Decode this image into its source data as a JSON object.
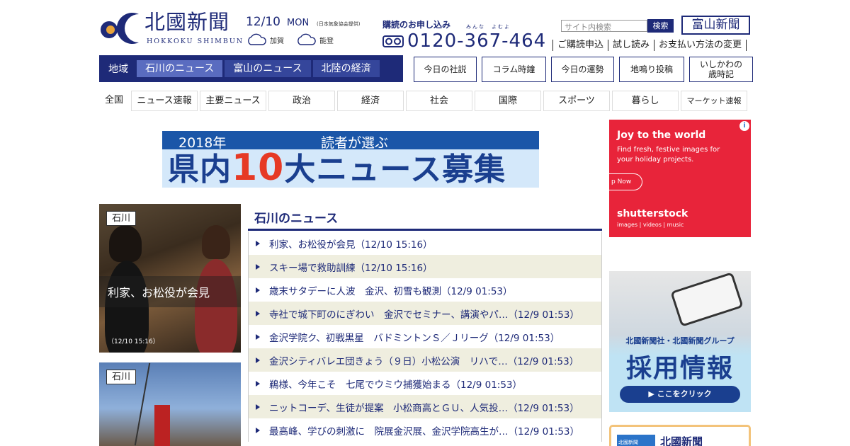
{
  "header": {
    "logo_title": "北國新聞",
    "logo_sub": "HOKKOKU SHIMBUN",
    "date": "12/10",
    "weekday": "MON",
    "weather_note": "(日本気象協会提供)",
    "weather": [
      {
        "area": "加賀",
        "icon": "cloud-icon"
      },
      {
        "area": "能登",
        "icon": "cloud-icon"
      }
    ],
    "subscribe_title": "購読のお申し込み",
    "subscribe_ruby": "みんな　よむよ",
    "phone": "0120-367-464",
    "search_placeholder": "サイト内検索",
    "search_button": "検索",
    "toyama_link": "富山新聞",
    "top_links": [
      "ご購読申込",
      "試し読み",
      "お支払い方法の変更"
    ]
  },
  "region_nav": {
    "label": "地域",
    "tabs": [
      "石川のニュース",
      "富山のニュース",
      "北陸の経済"
    ]
  },
  "box_links": [
    "今日の社説",
    "コラム時鐘",
    "今日の運勢",
    "地鳴り投稿",
    "いしかわの\n歳時記"
  ],
  "categories": [
    "全国",
    "ニュース速報",
    "主要ニュース",
    "政治",
    "経済",
    "社会",
    "国際",
    "スポーツ",
    "暮らし",
    "マーケット速報"
  ],
  "banner": {
    "year": "2018年",
    "subtitle": "読者が選ぶ",
    "main_pre": "県内",
    "main_num": "10",
    "main_post": "大ニュース募集"
  },
  "cards": [
    {
      "tag": "石川",
      "title": "利家、お松役が会見",
      "time": "（12/10 15:16）"
    },
    {
      "tag": "石川"
    }
  ],
  "news": {
    "heading": "石川のニュース",
    "items": [
      "利家、お松役が会見（12/10 15:16）",
      "スキー場で救助訓練（12/10 15:16）",
      "歳末サタデーに人波　金沢、初雪も観測（12/9 01:53）",
      "寺社で城下町のにぎわい　金沢でセミナー、講演やパ…（12/9 01:53）",
      "金沢学院ク、初戦黒星　バドミントンＳ／Ｊリーグ（12/9 01:53）",
      "金沢シティバレエ団きょう（９日）小松公演　リハで…（12/9 01:53）",
      "鵜様、今年こそ　七尾でウミウ捕獲始まる（12/9 01:53）",
      "ニットコーデ、生徒が提案　小松商高とＧＵ、人気投…（12/9 01:53）",
      "最高峰、学びの刺激に　院展金沢展、金沢学院高生が…（12/9 01:53）"
    ]
  },
  "ads": {
    "shutterstock": {
      "title": "Joy to the world",
      "text": "Find fresh, festive images for your holiday projects.",
      "button": "p Now",
      "brand": "shutterstock",
      "links": "images  |  videos  |  music",
      "info": "i"
    },
    "recruit": {
      "small": "北國新聞社・北國新聞グループ",
      "big": "採用情報",
      "button": "▶ ここをクリック"
    },
    "bottom": {
      "logo": "北國新聞",
      "text": "北國新聞"
    }
  },
  "colors": {
    "navy": "#1e2a78",
    "stripe": "#efeedf",
    "ad_red": "#e8243a",
    "banner_blue": "#1b56a8",
    "banner_red": "#e63a25"
  }
}
